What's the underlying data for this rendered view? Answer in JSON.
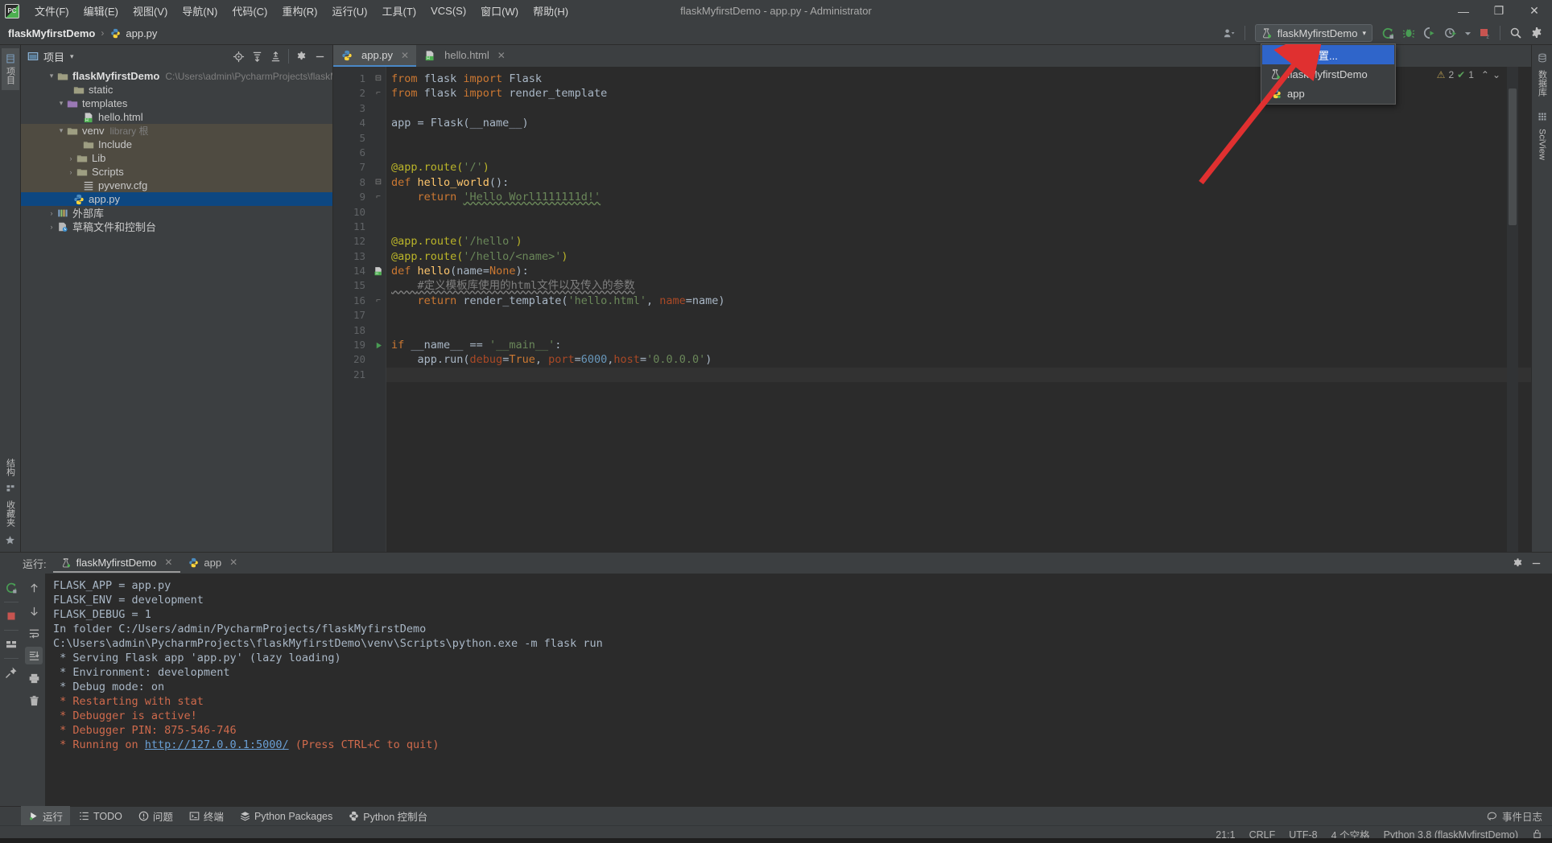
{
  "window": {
    "title": "flaskMyfirstDemo - app.py - Administrator",
    "minimize": "—",
    "maximize": "❐",
    "close": "✕"
  },
  "menubar": {
    "logo": "PC",
    "items": [
      {
        "label": "文件(F)"
      },
      {
        "label": "编辑(E)"
      },
      {
        "label": "视图(V)"
      },
      {
        "label": "导航(N)"
      },
      {
        "label": "代码(C)"
      },
      {
        "label": "重构(R)"
      },
      {
        "label": "运行(U)"
      },
      {
        "label": "工具(T)"
      },
      {
        "label": "VCS(S)"
      },
      {
        "label": "窗口(W)"
      },
      {
        "label": "帮助(H)"
      }
    ]
  },
  "navbar": {
    "breadcrumb": {
      "project": "flaskMyfirstDemo",
      "separator": "›",
      "file": "app.py"
    },
    "run_config": {
      "name": "flaskMyfirstDemo",
      "chevron": "▾"
    },
    "icons": [
      "profile-icon",
      "run-icon",
      "debug-icon",
      "coverage-icon",
      "profiler-icon",
      "stop-icon",
      "search-icon",
      "settings-icon"
    ]
  },
  "run_config_dropdown": {
    "items": [
      {
        "label": "编辑配置...",
        "icon": "none",
        "highlighted": true
      },
      {
        "label": "flaskMyfirstDemo",
        "icon": "flask-icon",
        "highlighted": false
      },
      {
        "label": "app",
        "icon": "python-icon",
        "highlighted": false
      }
    ]
  },
  "left_rail": {
    "top": [
      {
        "label": "项目"
      }
    ],
    "bottom": [
      {
        "label": "结构"
      },
      {
        "label": "收藏夹"
      }
    ]
  },
  "right_rail": {
    "items": [
      {
        "label": "数据库"
      },
      {
        "label": "SciView"
      }
    ]
  },
  "project_panel": {
    "title": "项目",
    "chevron": "▾",
    "toolbar_icons": [
      "locate-icon",
      "expand-all-icon",
      "collapse-all-icon",
      "settings-icon",
      "hide-icon"
    ],
    "tree": [
      {
        "indent": 0,
        "twisty": "v",
        "icon": "folder",
        "label": "flaskMyfirstDemo",
        "bold": true,
        "sub": "C:\\Users\\admin\\PycharmProjects\\flaskMyfirstDemo",
        "state": "normal"
      },
      {
        "indent": 1,
        "twisty": "",
        "icon": "folder",
        "label": "static",
        "bold": false,
        "sub": "",
        "state": "normal"
      },
      {
        "indent": 1,
        "twisty": "v",
        "icon": "folder-purple",
        "label": "templates",
        "bold": false,
        "sub": "",
        "state": "normal"
      },
      {
        "indent": 2,
        "twisty": "",
        "icon": "html",
        "label": "hello.html",
        "bold": false,
        "sub": "",
        "state": "normal"
      },
      {
        "indent": 1,
        "twisty": "v",
        "icon": "folder",
        "label": "venv",
        "bold": false,
        "sub": "library 根",
        "state": "lib"
      },
      {
        "indent": 2,
        "twisty": "",
        "icon": "folder",
        "label": "Include",
        "bold": false,
        "sub": "",
        "state": "lib"
      },
      {
        "indent": 2,
        "twisty": ">",
        "icon": "folder",
        "label": "Lib",
        "bold": false,
        "sub": "",
        "state": "lib"
      },
      {
        "indent": 2,
        "twisty": ">",
        "icon": "folder",
        "label": "Scripts",
        "bold": false,
        "sub": "",
        "state": "lib"
      },
      {
        "indent": 2,
        "twisty": "",
        "icon": "cfg",
        "label": "pyvenv.cfg",
        "bold": false,
        "sub": "",
        "state": "lib"
      },
      {
        "indent": 1,
        "twisty": "",
        "icon": "python",
        "label": "app.py",
        "bold": false,
        "sub": "",
        "state": "selected"
      },
      {
        "indent": 0,
        "twisty": ">",
        "icon": "extlib",
        "label": "外部库",
        "bold": false,
        "sub": "",
        "state": "normal"
      },
      {
        "indent": 0,
        "twisty": ">",
        "icon": "scratch",
        "label": "草稿文件和控制台",
        "bold": false,
        "sub": "",
        "state": "normal"
      }
    ]
  },
  "editor": {
    "tabs": [
      {
        "label": "app.py",
        "icon": "python-icon",
        "active": true,
        "close": "✕"
      },
      {
        "label": "hello.html",
        "icon": "html-icon",
        "active": false,
        "close": "✕"
      }
    ],
    "inspections": {
      "warning_icon": "⚠",
      "warning_count": "2",
      "ok_icon": "✔",
      "ok_count": "1",
      "up": "⌃",
      "down": "⌄"
    },
    "lines": [
      {
        "n": "1",
        "fold": "−",
        "marker": "",
        "tokens": [
          {
            "t": "from ",
            "c": "kw"
          },
          {
            "t": "flask ",
            "c": "pln"
          },
          {
            "t": "import ",
            "c": "kw"
          },
          {
            "t": "Flask",
            "c": "pln"
          }
        ]
      },
      {
        "n": "2",
        "fold": "⌐",
        "marker": "",
        "tokens": [
          {
            "t": "from ",
            "c": "kw"
          },
          {
            "t": "flask ",
            "c": "pln"
          },
          {
            "t": "import ",
            "c": "kw"
          },
          {
            "t": "render_template",
            "c": "pln"
          }
        ]
      },
      {
        "n": "3",
        "fold": "",
        "marker": "",
        "tokens": []
      },
      {
        "n": "4",
        "fold": "",
        "marker": "",
        "tokens": [
          {
            "t": "app = Flask(__name__)",
            "c": "pln"
          }
        ]
      },
      {
        "n": "5",
        "fold": "",
        "marker": "",
        "tokens": []
      },
      {
        "n": "6",
        "fold": "",
        "marker": "",
        "tokens": []
      },
      {
        "n": "7",
        "fold": "",
        "marker": "",
        "tokens": [
          {
            "t": "@app.route(",
            "c": "dec"
          },
          {
            "t": "'/'",
            "c": "str"
          },
          {
            "t": ")",
            "c": "dec"
          }
        ]
      },
      {
        "n": "8",
        "fold": "−",
        "marker": "",
        "tokens": [
          {
            "t": "def ",
            "c": "kw"
          },
          {
            "t": "hello_world",
            "c": "fn"
          },
          {
            "t": "():",
            "c": "pln"
          }
        ]
      },
      {
        "n": "9",
        "fold": "⌐",
        "marker": "",
        "tokens": [
          {
            "t": "    ",
            "c": "pln"
          },
          {
            "t": "return ",
            "c": "kw"
          },
          {
            "t": "'Hello Worl1111111d!'",
            "c": "str"
          }
        ]
      },
      {
        "n": "10",
        "fold": "",
        "marker": "",
        "tokens": []
      },
      {
        "n": "11",
        "fold": "",
        "marker": "",
        "tokens": []
      },
      {
        "n": "12",
        "fold": "",
        "marker": "",
        "tokens": [
          {
            "t": "@app.route(",
            "c": "dec"
          },
          {
            "t": "'/hello'",
            "c": "str"
          },
          {
            "t": ")",
            "c": "dec"
          }
        ]
      },
      {
        "n": "13",
        "fold": "",
        "marker": "",
        "tokens": [
          {
            "t": "@app.route(",
            "c": "dec"
          },
          {
            "t": "'/hello/<name>'",
            "c": "str"
          },
          {
            "t": ")",
            "c": "dec"
          }
        ]
      },
      {
        "n": "14",
        "fold": "−",
        "marker": "html",
        "tokens": [
          {
            "t": "def ",
            "c": "kw"
          },
          {
            "t": "hello",
            "c": "fn"
          },
          {
            "t": "(",
            "c": "pln"
          },
          {
            "t": "name",
            "c": "pln"
          },
          {
            "t": "=",
            "c": "pln"
          },
          {
            "t": "None",
            "c": "kw"
          },
          {
            "t": "):",
            "c": "pln"
          }
        ]
      },
      {
        "n": "15",
        "fold": "",
        "marker": "",
        "tokens": [
          {
            "t": "    ",
            "c": "pln"
          },
          {
            "t": "#定义模板库使用的html文件以及传入的参数",
            "c": "cmt"
          }
        ]
      },
      {
        "n": "16",
        "fold": "⌐",
        "marker": "",
        "tokens": [
          {
            "t": "    ",
            "c": "pln"
          },
          {
            "t": "return ",
            "c": "kw"
          },
          {
            "t": "render_template(",
            "c": "pln"
          },
          {
            "t": "'hello.html'",
            "c": "str"
          },
          {
            "t": ", ",
            "c": "pln"
          },
          {
            "t": "name",
            "c": "param"
          },
          {
            "t": "=name)",
            "c": "pln"
          }
        ]
      },
      {
        "n": "17",
        "fold": "",
        "marker": "",
        "tokens": []
      },
      {
        "n": "18",
        "fold": "",
        "marker": "",
        "tokens": []
      },
      {
        "n": "19",
        "fold": "",
        "marker": "run",
        "tokens": [
          {
            "t": "if ",
            "c": "kw"
          },
          {
            "t": "__name__ == ",
            "c": "pln"
          },
          {
            "t": "'__main__'",
            "c": "str"
          },
          {
            "t": ":",
            "c": "pln"
          }
        ]
      },
      {
        "n": "20",
        "fold": "",
        "marker": "",
        "tokens": [
          {
            "t": "    ",
            "c": "pln"
          },
          {
            "t": "app.run(",
            "c": "pln"
          },
          {
            "t": "debug",
            "c": "param"
          },
          {
            "t": "=",
            "c": "pln"
          },
          {
            "t": "True",
            "c": "kw"
          },
          {
            "t": ", ",
            "c": "pln"
          },
          {
            "t": "port",
            "c": "param"
          },
          {
            "t": "=",
            "c": "pln"
          },
          {
            "t": "6000",
            "c": "num"
          },
          {
            "t": ",",
            "c": "pln"
          },
          {
            "t": "host",
            "c": "param"
          },
          {
            "t": "=",
            "c": "pln"
          },
          {
            "t": "'0.0.0.0'",
            "c": "str"
          },
          {
            "t": ")",
            "c": "pln"
          }
        ]
      },
      {
        "n": "21",
        "fold": "",
        "marker": "",
        "tokens": [],
        "current": true
      }
    ]
  },
  "run_panel": {
    "label": "运行:",
    "tabs": [
      {
        "label": "flaskMyfirstDemo",
        "icon": "flask-icon",
        "active": true,
        "close": "✕"
      },
      {
        "label": "app",
        "icon": "python-icon",
        "active": false,
        "close": "✕"
      }
    ],
    "toolbar_left": [
      "rerun-icon",
      "stop-icon",
      "layout-icon",
      "pin-icon"
    ],
    "toolbar_right": [
      "up-icon",
      "down-icon",
      "soft-wrap-icon",
      "scroll-end-icon",
      "print-icon",
      "trash-icon"
    ],
    "settings_icon": "gear-icon",
    "hide_icon": "minimize-icon",
    "console": [
      {
        "text": "FLASK_APP = app.py",
        "color": "normal"
      },
      {
        "text": "FLASK_ENV = development",
        "color": "normal"
      },
      {
        "text": "FLASK_DEBUG = 1",
        "color": "normal"
      },
      {
        "text": "In folder C:/Users/admin/PycharmProjects/flaskMyfirstDemo",
        "color": "normal"
      },
      {
        "text": "C:\\Users\\admin\\PycharmProjects\\flaskMyfirstDemo\\venv\\Scripts\\python.exe -m flask run",
        "color": "normal"
      },
      {
        "text": " * Serving Flask app 'app.py' (lazy loading)",
        "color": "normal"
      },
      {
        "text": " * Environment: development",
        "color": "normal"
      },
      {
        "text": " * Debug mode: on",
        "color": "normal"
      },
      {
        "text": " * Restarting with stat",
        "color": "red"
      },
      {
        "text": " * Debugger is active!",
        "color": "red"
      },
      {
        "text": " * Debugger PIN: 875-546-746",
        "color": "red"
      },
      {
        "text": " * Running on ",
        "color": "red",
        "link": "http://127.0.0.1:5000/",
        "after": " (Press CTRL+C to quit)"
      }
    ]
  },
  "toolwindow_bar": {
    "items": [
      {
        "label": "运行",
        "icon": "run-icon",
        "active": true
      },
      {
        "label": "TODO",
        "icon": "todo-icon",
        "active": false
      },
      {
        "label": "问题",
        "icon": "problems-icon",
        "active": false
      },
      {
        "label": "终端",
        "icon": "terminal-icon",
        "active": false
      },
      {
        "label": "Python Packages",
        "icon": "packages-icon",
        "active": false
      },
      {
        "label": "Python 控制台",
        "icon": "python-console-icon",
        "active": false
      }
    ],
    "event_log": {
      "label": "事件日志",
      "icon": "event-log-icon"
    }
  },
  "statusbar": {
    "caret": "21:1",
    "line_separator": "CRLF",
    "encoding": "UTF-8",
    "indent": "4 个空格",
    "interpreter": "Python 3.8 (flaskMyfirstDemo)",
    "lock_icon": "lock-icon"
  },
  "colors": {
    "chrome": "#3c3f41",
    "editor_bg": "#2b2b2b",
    "gutter_bg": "#313335",
    "selection": "#0d4781",
    "library_row": "#4f4b41",
    "accent_blue": "#2f65ca",
    "keyword": "#cc7832",
    "string": "#6a8759",
    "number": "#6897bb",
    "decorator": "#bbb529",
    "function": "#ffc66d",
    "comment": "#808080",
    "console_red": "#cf6a4c",
    "annotation_arrow": "#e03030"
  }
}
